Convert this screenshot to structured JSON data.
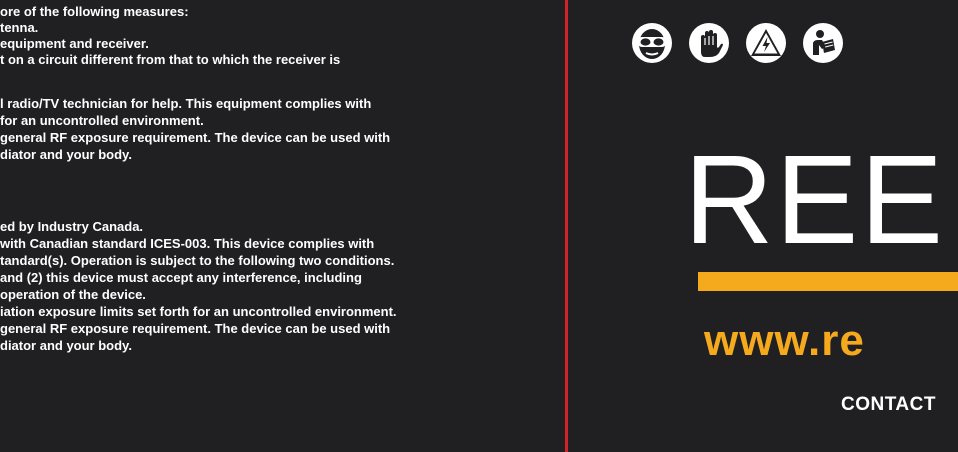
{
  "left_text": {
    "lines": [
      "ore of the following measures:",
      "tenna.",
      " equipment and receiver.",
      "t on a circuit different from that to which the receiver is",
      "",
      "l radio/TV technician for help. This equipment complies with",
      "for an uncontrolled environment.",
      " general RF exposure requirement. The device can be used with",
      "diator and your body.",
      "",
      "",
      "ed by Industry Canada.",
      "with Canadian standard ICES-003. This device complies with",
      "tandard(s). Operation is subject to the following two conditions.",
      "and (2) this device must accept any interference, including",
      "operation of the device.",
      "iation exposure limits set forth for an uncontrolled environment.",
      " general RF exposure requirement. The device can be used with",
      "diator and your body."
    ]
  },
  "safety_icons": [
    {
      "icon": "safety-glasses-icon"
    },
    {
      "icon": "gloves-icon"
    },
    {
      "icon": "high-voltage-warning-icon"
    },
    {
      "icon": "read-manual-icon"
    }
  ],
  "brand": {
    "name": "REE",
    "url": "www.re",
    "contact": "CONTACT"
  },
  "colors": {
    "background": "#202023",
    "divider": "#d0242a",
    "accent": "#f5a91c",
    "text": "#ffffff"
  }
}
